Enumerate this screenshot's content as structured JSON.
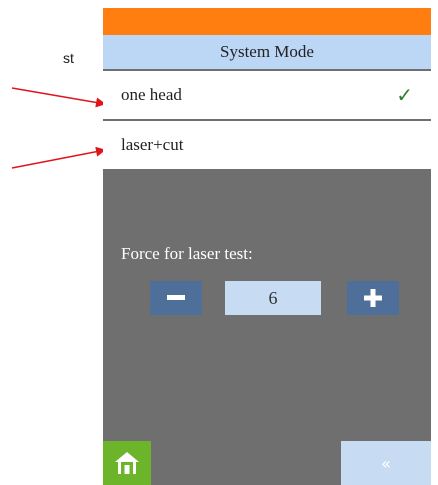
{
  "annotation": {
    "partial_text": "st",
    "arrow_color": "#e0151b"
  },
  "screen": {
    "header_color": "#ff7e0f",
    "title": "System Mode",
    "items": [
      {
        "label": "one head",
        "selected": true,
        "check_icon": "check-icon"
      },
      {
        "label": "laser+cut",
        "selected": false
      }
    ],
    "force": {
      "label": "Force for laser test:",
      "value": "6",
      "minus_icon": "minus-icon",
      "plus_icon": "plus-icon"
    },
    "footer": {
      "home_icon": "home-icon",
      "back_icon": "double-chevron-left-icon",
      "back_symbol": "«"
    },
    "colors": {
      "background": "#6f6f6f",
      "title_bar": "#bcd6f6",
      "stepper": "#4e6f9a",
      "value_box": "#c7dcf3",
      "home_button": "#6cb42a",
      "check": "#2e7d32"
    }
  }
}
